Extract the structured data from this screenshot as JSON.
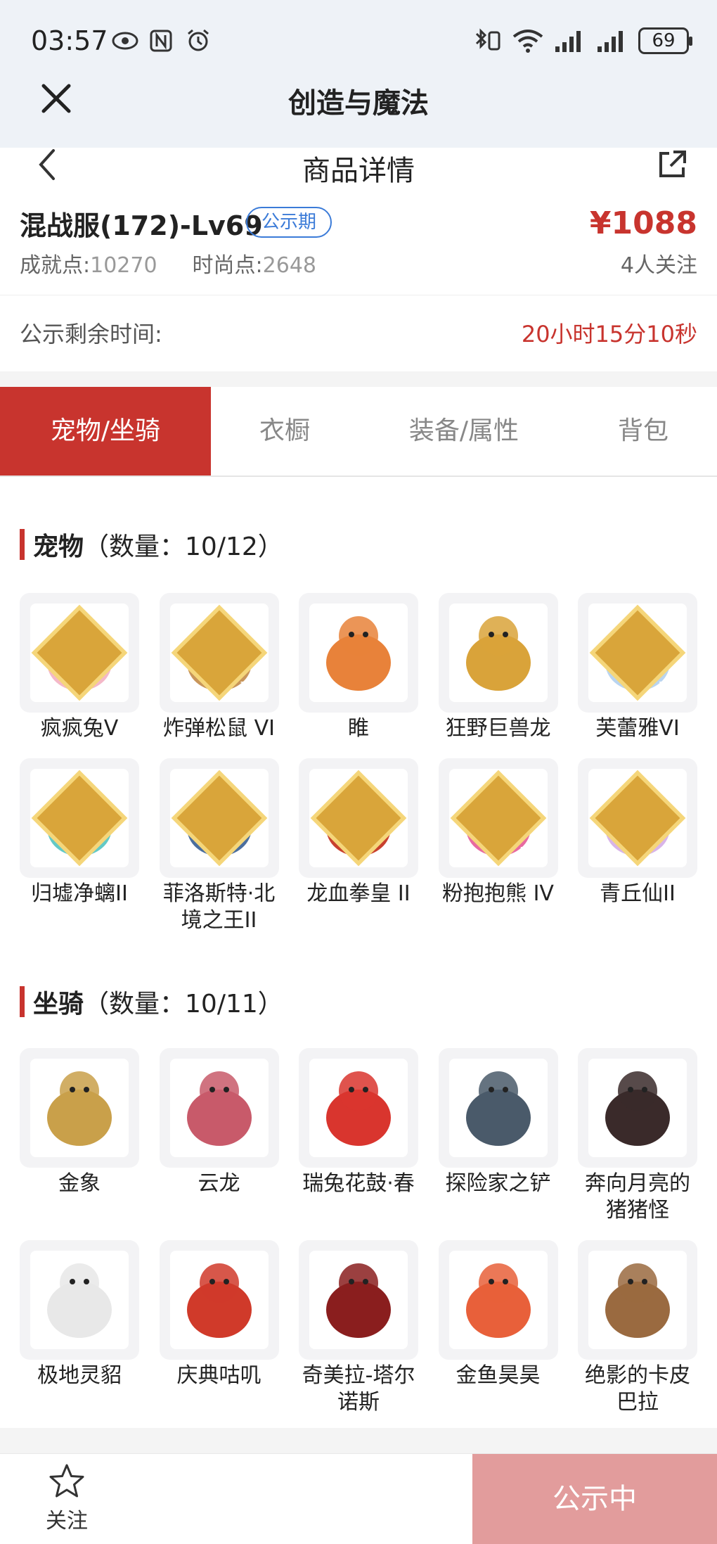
{
  "status_bar": {
    "time": "03:57",
    "battery": "69"
  },
  "app": {
    "title": "创造与魔法"
  },
  "page": {
    "title": "商品详情"
  },
  "listing": {
    "name": "混战服(172)-Lv69",
    "badge": "公示期",
    "price": "¥1088",
    "achievement_label": "成就点:",
    "achievement_value": "10270",
    "fashion_label": "时尚点:",
    "fashion_value": "2648",
    "followers": "4人关注"
  },
  "timer": {
    "label": "公示剩余时间:",
    "value": "20小时15分10秒"
  },
  "tabs": [
    {
      "label": "宠物/坐骑",
      "active": true
    },
    {
      "label": "衣橱",
      "active": false
    },
    {
      "label": "装备/属性",
      "active": false
    },
    {
      "label": "背包",
      "active": false
    }
  ],
  "pets": {
    "title": "宠物",
    "count": "（数量：10/12）",
    "items": [
      {
        "name": "疯疯兔V",
        "grade": "V",
        "icon": "rabbit-pet-icon",
        "color": "#f4b8c8"
      },
      {
        "name": "炸弹松鼠 VI",
        "grade": "VI",
        "icon": "squirrel-pet-icon",
        "color": "#c8955a"
      },
      {
        "name": "睢",
        "grade": "",
        "icon": "dragon-pet-icon",
        "color": "#e8823a"
      },
      {
        "name": "狂野巨兽龙",
        "grade": "",
        "icon": "beast-dragon-pet-icon",
        "color": "#d9a33a"
      },
      {
        "name": "芙蕾雅VI",
        "grade": "VI",
        "icon": "valkyrie-pet-icon",
        "color": "#b9d4f0"
      },
      {
        "name": "归墟净螭II",
        "grade": "II",
        "icon": "water-dragon-pet-icon",
        "color": "#63c9c6"
      },
      {
        "name": "菲洛斯特·北境之王II",
        "grade": "II",
        "icon": "frost-king-pet-icon",
        "color": "#4b6e9e"
      },
      {
        "name": "龙血拳皇 II",
        "grade": "II",
        "icon": "dragon-fist-pet-icon",
        "color": "#c8402e"
      },
      {
        "name": "粉抱抱熊 IV",
        "grade": "IV",
        "icon": "pink-bear-pet-icon",
        "color": "#e86aa0"
      },
      {
        "name": "青丘仙II",
        "grade": "II",
        "icon": "fox-fairy-pet-icon",
        "color": "#d8b4e8"
      }
    ]
  },
  "mounts": {
    "title": "坐骑",
    "count": "（数量：10/11）",
    "items": [
      {
        "name": "金象",
        "icon": "golden-elephant-mount-icon",
        "color": "#c9a04a"
      },
      {
        "name": "云龙",
        "icon": "cloud-dragon-mount-icon",
        "color": "#c85a6a"
      },
      {
        "name": "瑞兔花鼓·春",
        "icon": "drum-mount-icon",
        "color": "#d9352e"
      },
      {
        "name": "探险家之铲",
        "icon": "shovel-mount-icon",
        "color": "#4a5a6a"
      },
      {
        "name": "奔向月亮的猪猪怪",
        "icon": "pig-mount-icon",
        "color": "#3a2a2a"
      },
      {
        "name": "极地灵貂",
        "icon": "arctic-marten-mount-icon",
        "color": "#e8e8e8"
      },
      {
        "name": "庆典咕叽",
        "icon": "celebration-penguin-mount-icon",
        "color": "#d03a2a"
      },
      {
        "name": "奇美拉-塔尔诺斯",
        "icon": "chimera-mount-icon",
        "color": "#8a1e1e"
      },
      {
        "name": "金鱼昊昊",
        "icon": "goldfish-mount-icon",
        "color": "#e8603a"
      },
      {
        "name": "绝影的卡皮巴拉",
        "icon": "capybara-mount-icon",
        "color": "#9a6a40"
      }
    ]
  },
  "bottom": {
    "follow_label": "关注",
    "status_label": "公示中"
  },
  "colors": {
    "accent": "#c8342e",
    "badge_blue": "#3b7bd8",
    "status_button": "#e29c9c"
  }
}
